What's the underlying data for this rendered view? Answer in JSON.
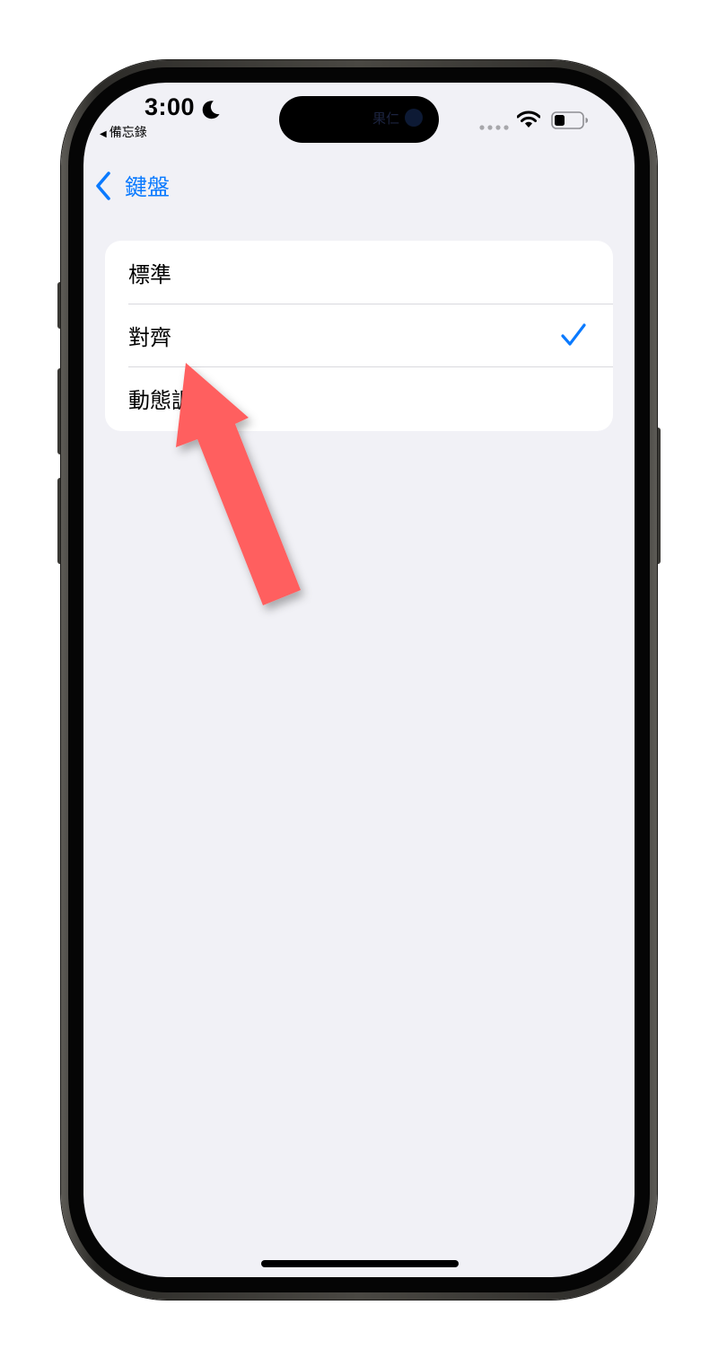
{
  "status_bar": {
    "time": "3:00",
    "back_app": "備忘錄",
    "island_text": "果仁"
  },
  "nav": {
    "back_label": "鍵盤"
  },
  "options": [
    {
      "label": "標準",
      "selected": false
    },
    {
      "label": "對齊",
      "selected": true
    },
    {
      "label": "動態調整",
      "selected": false
    }
  ],
  "icons": {
    "moon": "moon-icon",
    "wifi": "wifi-icon",
    "battery": "battery-icon",
    "back": "chevron-left-icon",
    "check": "checkmark-icon"
  },
  "colors": {
    "accent": "#0a7aff",
    "background": "#f1f1f6",
    "annotation_arrow": "#ff5f5f"
  }
}
